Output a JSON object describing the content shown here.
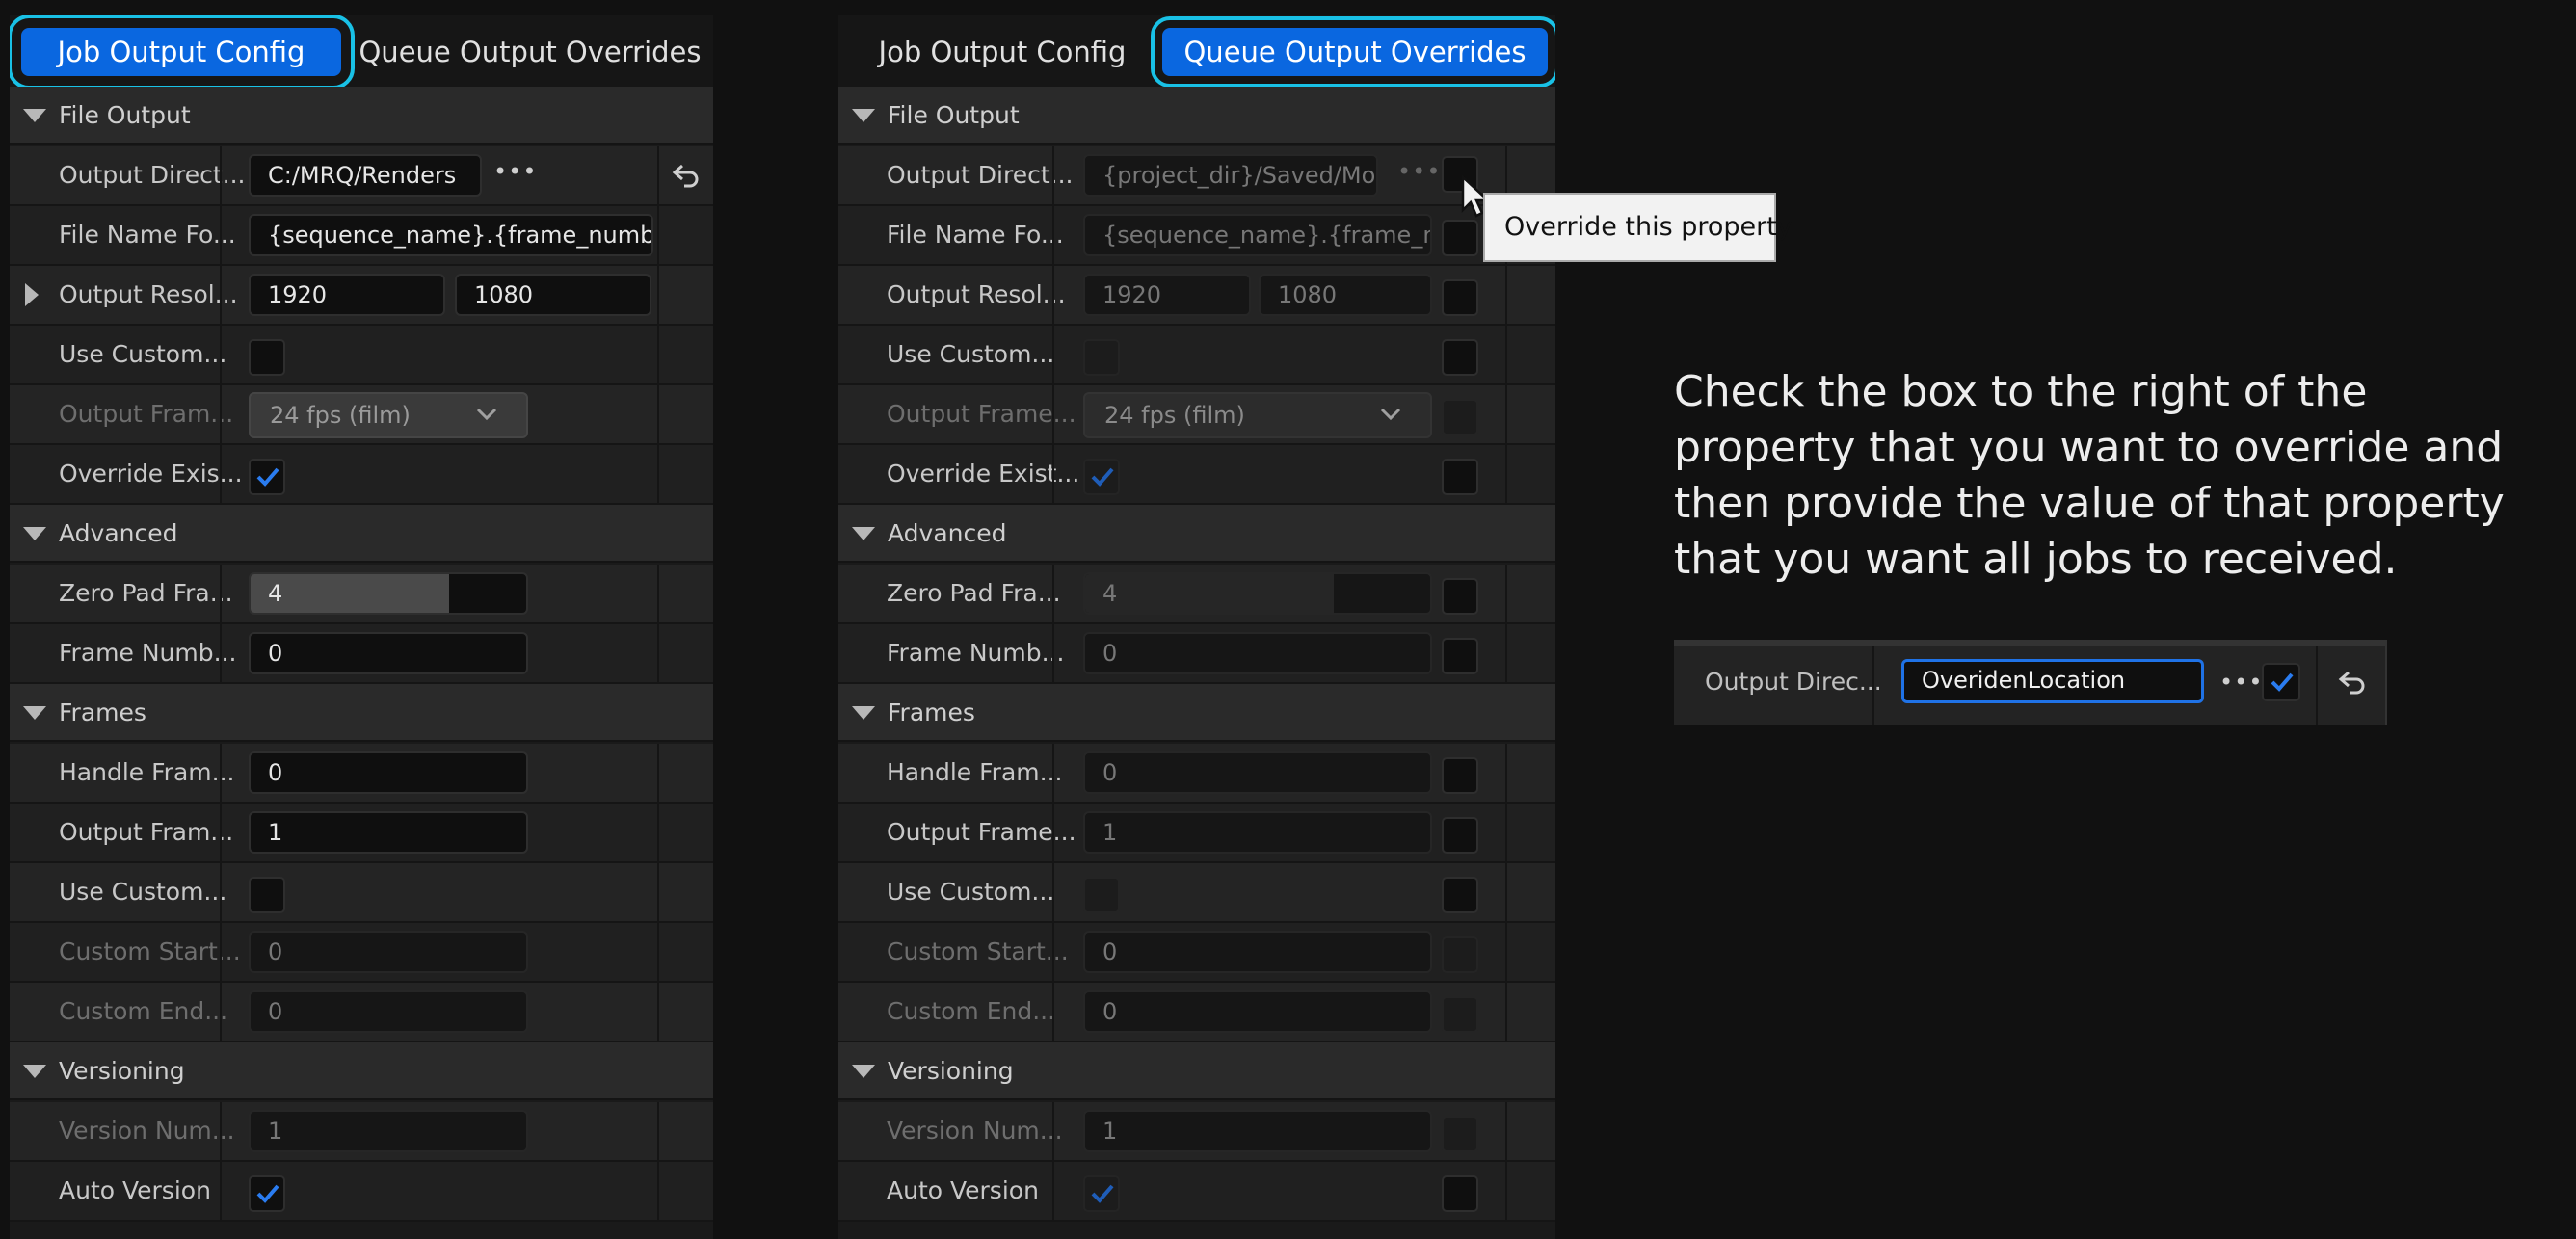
{
  "left": {
    "tabs": [
      "Job Output Config",
      "Queue Output Overrides"
    ],
    "active_tab": 0,
    "sections": {
      "file_output": "File Output",
      "advanced": "Advanced",
      "frames": "Frames",
      "versioning": "Versioning"
    },
    "rows": {
      "output_directory": {
        "label": "Output Direct...",
        "value": "C:/MRQ/Renders"
      },
      "file_name_format": {
        "label": "File Name Fo...",
        "value": "{sequence_name}.{frame_number"
      },
      "output_resolution": {
        "label": "Output Resol...",
        "x": "1920",
        "y": "1080"
      },
      "use_custom_fps": {
        "label": "Use Custom..."
      },
      "output_framerate": {
        "label": "Output Fram...",
        "value": "24 fps (film)"
      },
      "override_existing": {
        "label": "Override Exis...",
        "checked": true
      },
      "zero_pad": {
        "label": "Zero Pad Fra...",
        "value": "4",
        "fill": 0.72
      },
      "frame_number_offset": {
        "label": "Frame Numb...",
        "value": "0"
      },
      "handle_frame_count": {
        "label": "Handle Fram...",
        "value": "0"
      },
      "output_frame_step": {
        "label": "Output Fram...",
        "value": "1"
      },
      "use_custom_playback": {
        "label": "Use Custom..."
      },
      "custom_start": {
        "label": "Custom Start...",
        "value": "0"
      },
      "custom_end": {
        "label": "Custom End...",
        "value": "0"
      },
      "version_number": {
        "label": "Version Num...",
        "value": "1"
      },
      "auto_version": {
        "label": "Auto Version",
        "checked": true
      }
    }
  },
  "right": {
    "tabs": [
      "Job Output Config",
      "Queue Output Overrides"
    ],
    "active_tab": 1,
    "sections": {
      "file_output": "File Output",
      "advanced": "Advanced",
      "frames": "Frames",
      "versioning": "Versioning"
    },
    "rows": {
      "output_directory": {
        "label": "Output Direct...",
        "value": "{project_dir}/Saved/Mov"
      },
      "file_name_format": {
        "label": "File Name Fo...",
        "value": "{sequence_name}.{frame_nu"
      },
      "output_resolution": {
        "label": "Output Resol...",
        "x": "1920",
        "y": "1080"
      },
      "use_custom_fps": {
        "label": "Use Custom..."
      },
      "output_framerate": {
        "label": "Output Frame...",
        "value": "24 fps (film)"
      },
      "override_existing": {
        "label": "Override Exist...",
        "checked": true
      },
      "zero_pad": {
        "label": "Zero Pad Fra...",
        "value": "4",
        "fill": 0.72
      },
      "frame_number_offset": {
        "label": "Frame Numb...",
        "value": "0"
      },
      "handle_frame_count": {
        "label": "Handle Fram...",
        "value": "0"
      },
      "output_frame_step": {
        "label": "Output Frame...",
        "value": "1"
      },
      "use_custom_playback": {
        "label": "Use Custom..."
      },
      "custom_start": {
        "label": "Custom Start...",
        "value": "0"
      },
      "custom_end": {
        "label": "Custom End...",
        "value": "0"
      },
      "version_number": {
        "label": "Version Num...",
        "value": "1"
      },
      "auto_version": {
        "label": "Auto Version",
        "checked": true
      }
    }
  },
  "tooltip": "Override this property",
  "instruction": "Check the box to the right of the property that you want to override and then provide the value of that property that you want all jobs to received.",
  "example": {
    "label": "Output Direc...",
    "value": "OveridenLocation",
    "checked": true
  },
  "colors": {
    "accent": "#0a67e0",
    "highlight": "#19c1e6",
    "check": "#2a7cf0"
  },
  "icons": [
    "caret-down-icon",
    "caret-right-icon",
    "checkmark-icon",
    "ellipsis-icon",
    "reset-arrow-icon",
    "chevron-down-icon",
    "mouse-cursor-icon"
  ]
}
